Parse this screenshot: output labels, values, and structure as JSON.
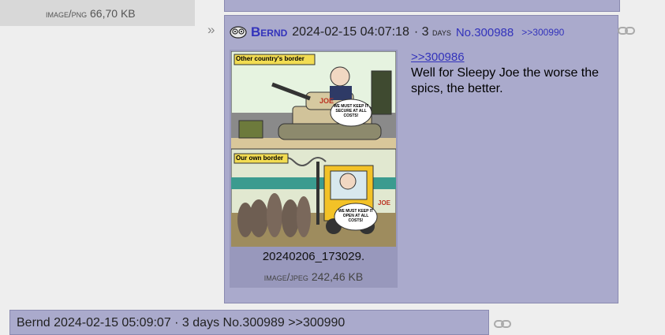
{
  "prev_post": {
    "file_type": "image/png",
    "file_size": "66,70 KB",
    "cut_text": "... ..."
  },
  "post": {
    "author": "Bernd",
    "date": "2024-02-15 04:07:18",
    "separator": "·",
    "age_num": "3",
    "age_unit": "days",
    "post_no_prefix": "No.",
    "post_no": "300988",
    "backlink": ">>300990",
    "file": {
      "name": "20240206_173029.",
      "type": "image/jpeg",
      "size": "242,46 KB"
    },
    "comic": {
      "panel1_caption": "Other country's border",
      "panel1_bubble": "WE MUST KEEP IT SECURE AT ALL COSTS!",
      "panel2_caption": "Our own border",
      "panel2_bubble": "WE MUST KEEP IT OPEN AT ALL COSTS!",
      "tank_label": "JOE",
      "forklift_label": "JOE"
    },
    "quote_link": ">>300986",
    "message": "Well for Sleepy Joe the worse the spics, the better."
  },
  "next_post": {
    "cut_text": "Bernd 2024-02-15 05:09:07 · 3 days No.300989 >>300990"
  },
  "colors": {
    "post_bg": "#aaaacc",
    "link": "#3333bb",
    "page_bg": "#eeeeee"
  }
}
